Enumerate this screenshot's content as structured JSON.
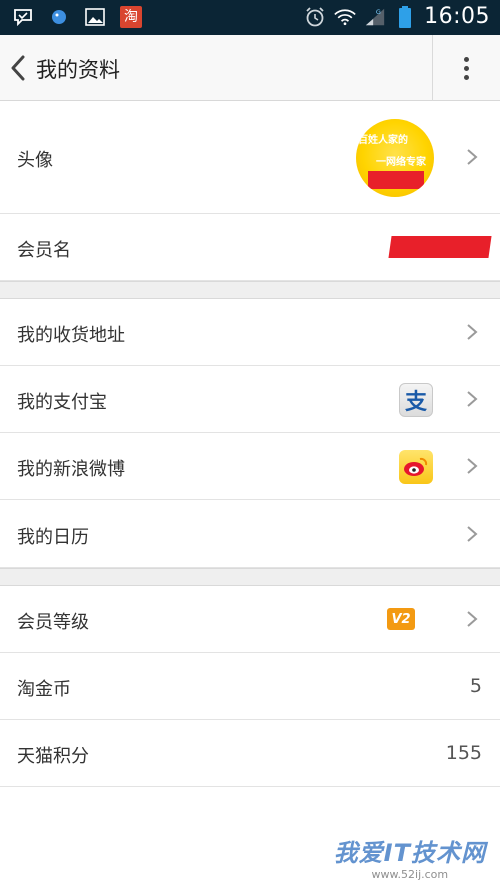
{
  "status_bar": {
    "time": "16:05",
    "taobao_icon_text": "淘",
    "icons": [
      "message-check-icon",
      "bird-icon",
      "gallery-icon",
      "taobao-icon",
      "alarm-icon",
      "wifi-icon",
      "signal-icon",
      "battery-icon"
    ]
  },
  "header": {
    "title": "我的资料"
  },
  "rows": {
    "avatar": {
      "label": "头像",
      "avatar_text_1": "百姓人家的",
      "avatar_text_2": "一网络专家"
    },
    "member_name": {
      "label": "会员名"
    },
    "address": {
      "label": "我的收货地址"
    },
    "alipay": {
      "label": "我的支付宝",
      "icon_text": "支"
    },
    "weibo": {
      "label": "我的新浪微博"
    },
    "calendar": {
      "label": "我的日历"
    },
    "member_level": {
      "label": "会员等级",
      "badge": "V2"
    },
    "taojinbi": {
      "label": "淘金币",
      "value": "5"
    },
    "tmall_points": {
      "label": "天猫积分",
      "value": "155"
    }
  },
  "watermark": {
    "main": "我爱IT技术网",
    "sub": "www.52ij.com"
  },
  "colors": {
    "status_bar": "#0b2535",
    "header_bg": "#f8f8f8",
    "section_gap": "#efefef",
    "redaction": "#e8202a",
    "level_badge": "#f39a12"
  }
}
